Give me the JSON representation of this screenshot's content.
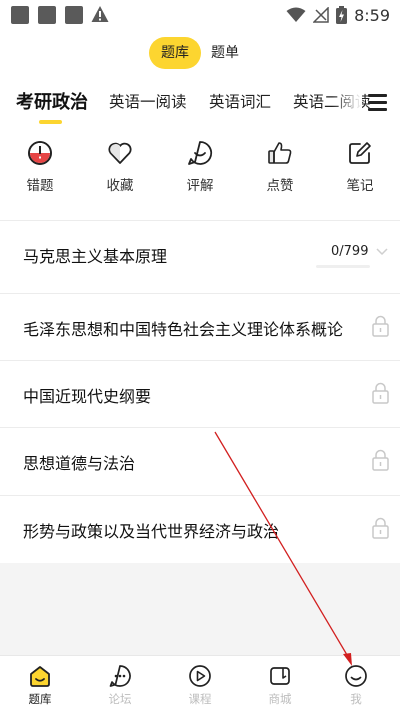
{
  "status_bar": {
    "time": "8:59"
  },
  "segment": {
    "active": "题库",
    "inactive": "题单"
  },
  "tabs": [
    {
      "label": "考研政治"
    },
    {
      "label": "英语一阅读"
    },
    {
      "label": "英语词汇"
    },
    {
      "label": "英语二阅读"
    }
  ],
  "quick_actions": [
    {
      "label": "错题",
      "icon": "wrong-question-icon"
    },
    {
      "label": "收藏",
      "icon": "heart-icon"
    },
    {
      "label": "评解",
      "icon": "smile-comment-icon"
    },
    {
      "label": "点赞",
      "icon": "thumbs-up-icon"
    },
    {
      "label": "笔记",
      "icon": "edit-note-icon"
    }
  ],
  "subjects": [
    {
      "title": "马克思主义基本原理",
      "progress": "0/799",
      "locked": false
    },
    {
      "title": "毛泽东思想和中国特色社会主义理论体系概论",
      "locked": true
    },
    {
      "title": "中国近现代史纲要",
      "locked": true
    },
    {
      "title": "思想道德与法治",
      "locked": true
    },
    {
      "title": "形势与政策以及当代世界经济与政治",
      "locked": true
    }
  ],
  "bottom_nav": [
    {
      "label": "题库",
      "icon": "home-icon",
      "active": true
    },
    {
      "label": "论坛",
      "icon": "chat-icon",
      "active": false
    },
    {
      "label": "课程",
      "icon": "play-icon",
      "active": false
    },
    {
      "label": "商城",
      "icon": "shop-icon",
      "active": false
    },
    {
      "label": "我",
      "icon": "profile-icon",
      "active": false
    }
  ],
  "colors": {
    "accent": "#fcd530",
    "wrong_icon": "#e64545",
    "arrow": "#d22020"
  }
}
